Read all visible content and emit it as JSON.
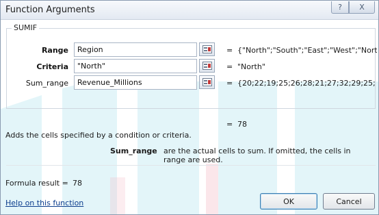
{
  "dialog": {
    "title": "Function Arguments",
    "help_glyph": "?",
    "close_glyph": "X"
  },
  "function": {
    "name": "SUMIF",
    "arguments": [
      {
        "label": "Range",
        "bold": true,
        "value": "Region",
        "result": "{\"North\";\"South\";\"East\";\"West\";\"Nortl"
      },
      {
        "label": "Criteria",
        "bold": true,
        "value": "\"North\"",
        "result": "\"North\""
      },
      {
        "label": "Sum_range",
        "bold": false,
        "value": "Revenue_Millions",
        "result": "{20;22;19;25;26;28;21;27;32;29;25;"
      }
    ],
    "equals": "=",
    "result": "78",
    "description": "Adds the cells specified by a condition or criteria.",
    "arg_help_name": "Sum_range",
    "arg_help_text": "are the actual cells to sum. If omitted, the cells in range are used."
  },
  "footer": {
    "formula_result_label": "Formula result =",
    "formula_result_value": "78",
    "help_link": "Help on this function",
    "ok_label": "OK",
    "cancel_label": "Cancel"
  },
  "colors": {
    "watermark": "#7fd3e3",
    "watermark_accent": "#f3b7c4",
    "link": "#0b3c8c"
  }
}
